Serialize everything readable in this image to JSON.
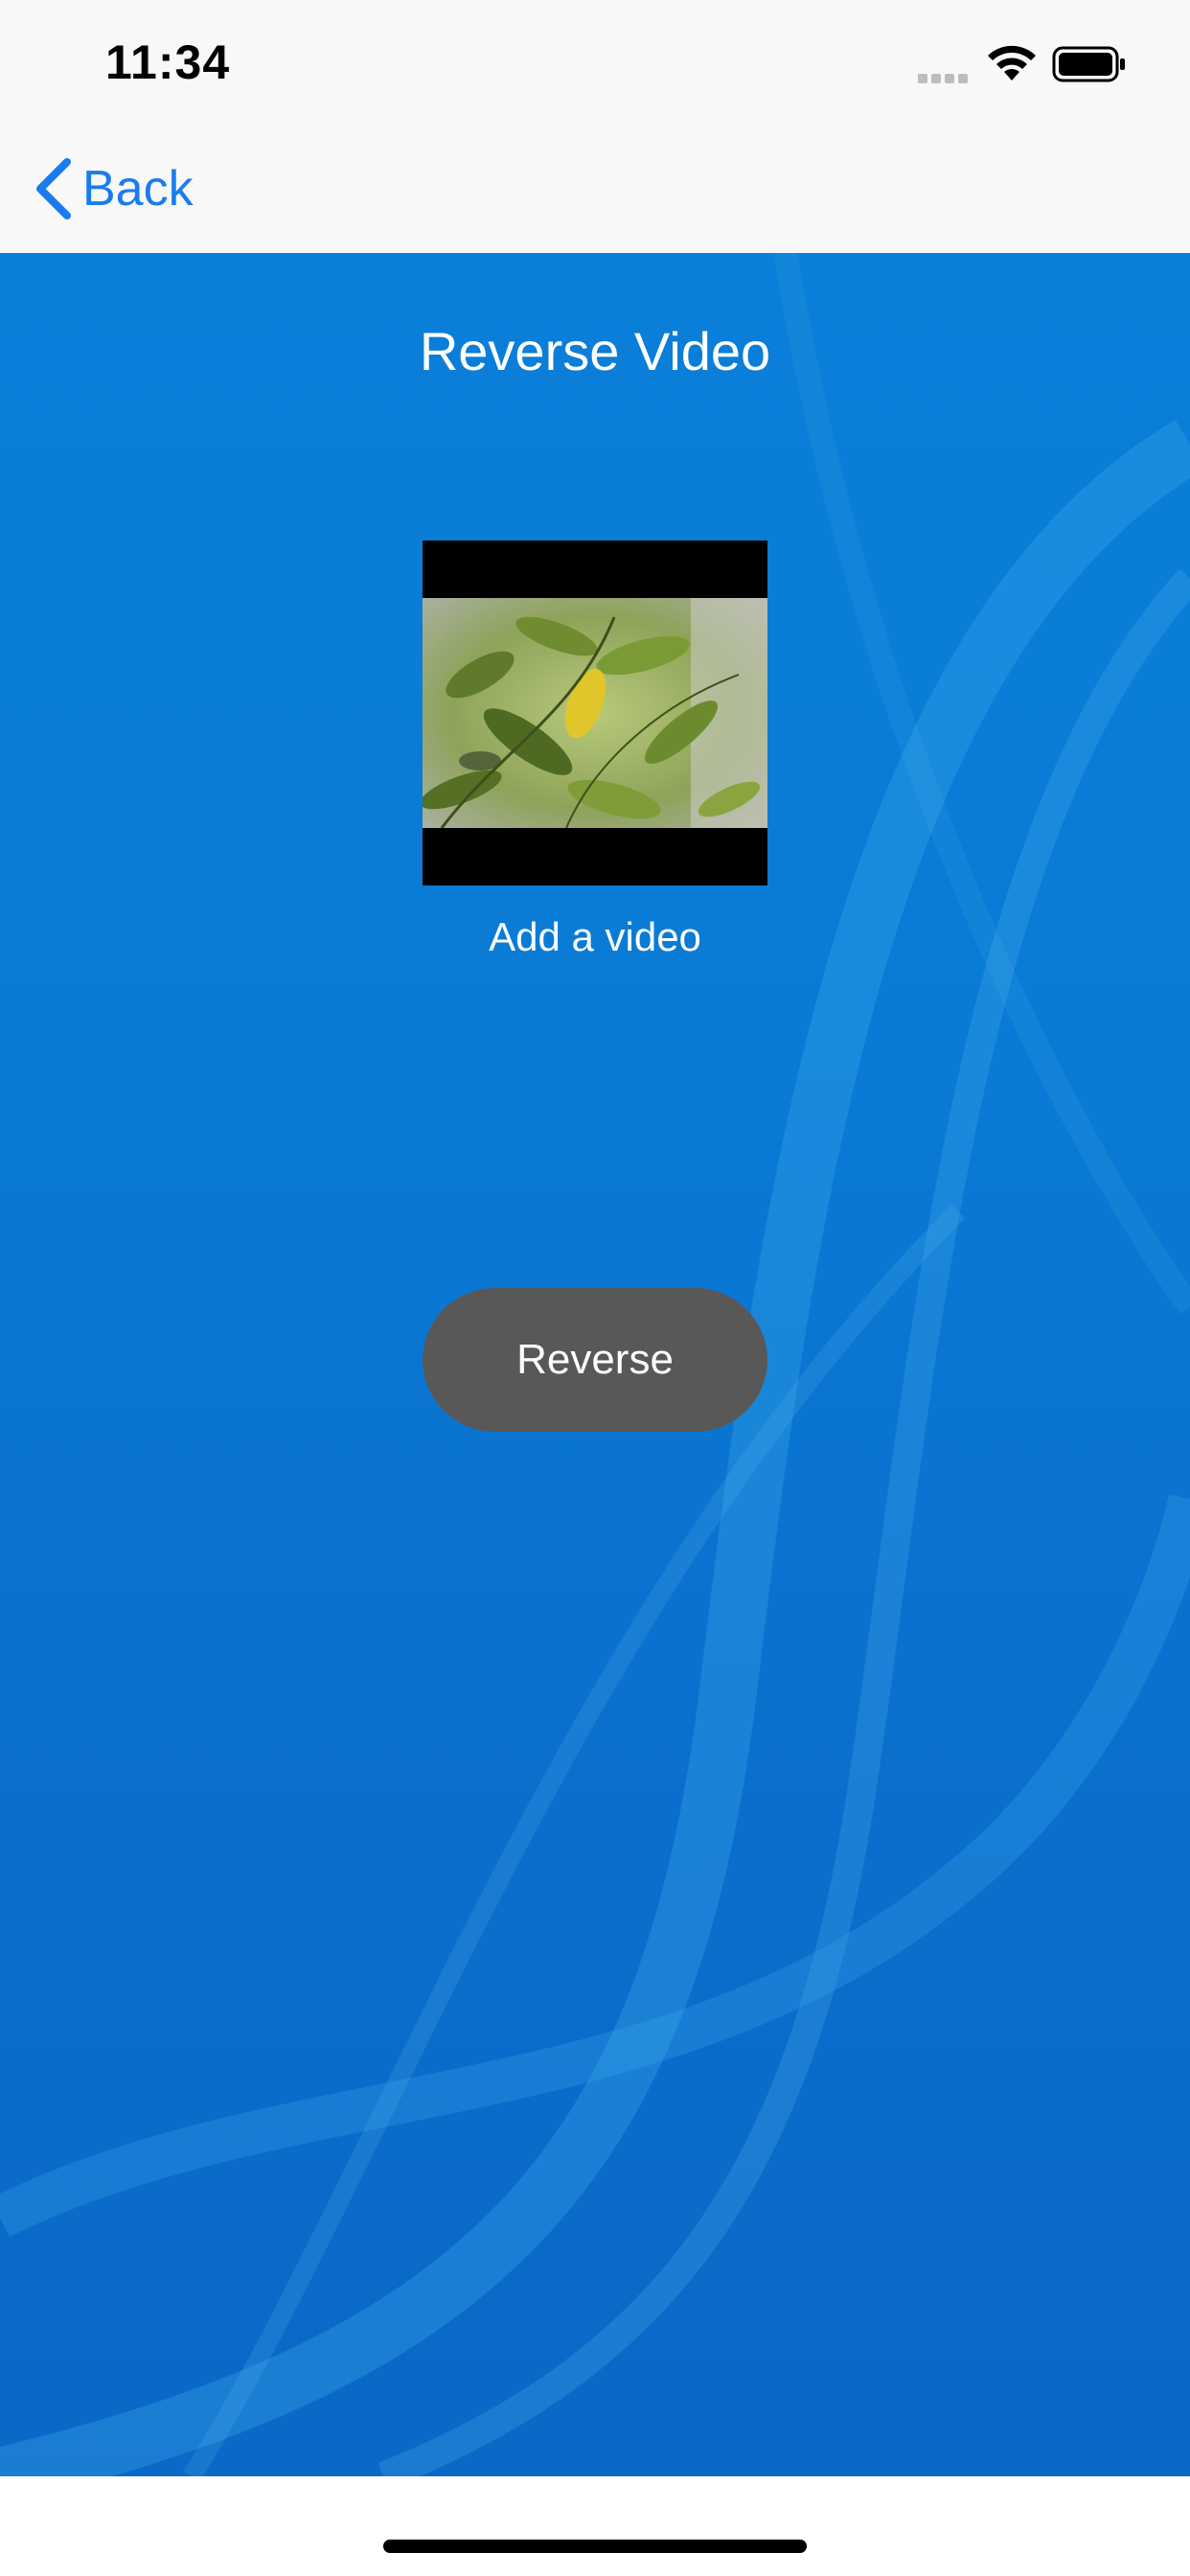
{
  "status_bar": {
    "time": "11:34",
    "signal_icon": "cellular-signal-icon",
    "wifi_icon": "wifi-icon",
    "battery_icon": "battery-full-icon"
  },
  "nav": {
    "back_label": "Back",
    "back_icon": "chevron-left-icon",
    "accent_color": "#1a7cf0"
  },
  "main": {
    "title": "Reverse Video",
    "video_thumbnail": "video-thumbnail",
    "add_video_label": "Add a video",
    "reverse_button_label": "Reverse",
    "background_color": "#0a7bd5",
    "button_color": "#585858"
  }
}
